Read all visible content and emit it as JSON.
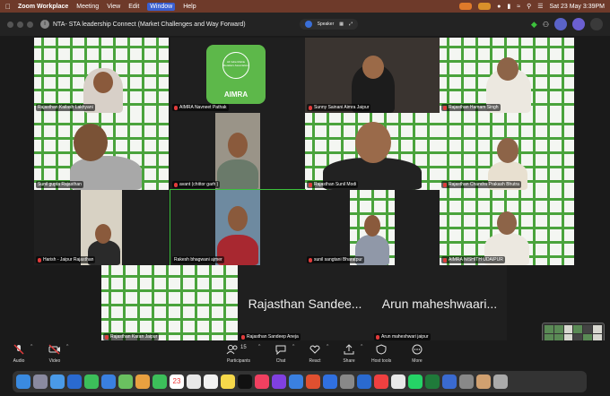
{
  "menubar": {
    "app": "Zoom Workplace",
    "items": [
      "Meeting",
      "View",
      "Edit",
      "Window",
      "Help"
    ],
    "datetime": "Sat 23 May  3:39PM"
  },
  "window": {
    "title": "NTA- STA leadership Connect (Market Challenges and Way Forward)",
    "view_label": "Speaker"
  },
  "tiles": [
    {
      "name": "Rajasthan Kailash Lakhyani"
    },
    {
      "name": "AIMRA Navneet Pathak",
      "logo_text": "AIMRA",
      "logo_small": "All India Mobile Retailers Association"
    },
    {
      "name": "Sunny Sainani Aimra Jaipur"
    },
    {
      "name": "Rajasthan Hamam Singh"
    },
    {
      "name": "Sunil gupta Rajasthan"
    },
    {
      "name": "avant (chittor garh )"
    },
    {
      "name": "Rajasthan Sunil Modi"
    },
    {
      "name": "Rajasthan Chandra Prakash Bhutra"
    },
    {
      "name": "Harish - Jaipur Rajasthan"
    },
    {
      "name": "Rakesh bhagwani ajmer"
    },
    {
      "name": "sunil sangtani Bharatpur"
    },
    {
      "name": "AIMRA NISHITH UDAIPUR"
    },
    {
      "name": "Rajasthan Karan Jaipur"
    },
    {
      "name": "Rajasthan Sandeep Aneja",
      "display": "Rajasthan Sandee..."
    },
    {
      "name": "Arun maheshwari jaipur",
      "display": "Arun maheshwaari..."
    }
  ],
  "toolbar": {
    "audio": "Audio",
    "video": "Video",
    "participants": "Participants",
    "participants_count": "15",
    "chat": "Chat",
    "react": "React",
    "share": "Share",
    "host_tools": "Host tools",
    "more": "More"
  },
  "dock": {
    "calendar_day": "23"
  },
  "colors": {
    "accent_green": "#4aa33c",
    "menubar_bg": "#6e3a2a",
    "mic_muted": "#e23b3b"
  }
}
